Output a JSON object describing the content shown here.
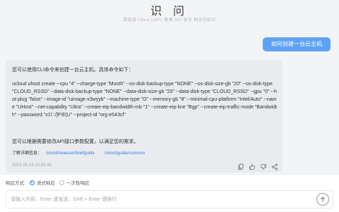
{
  "header": {
    "title": "识 问",
    "subtitle": "我知道 UHost URTC 备案 SPT 安全 相关的知识"
  },
  "chat": {
    "question": "如何创建一台云主机",
    "answer": {
      "intro": "您可以使用CLI命令来创建一台云主机。具体命令如下：",
      "command": "ucloud uhost create --cpu \"4\" --charge-type \"Month\" --os-disk-backup-type \"NONE\" --os-disk-size-gb \"20\" --os-disk-type \"CLOUD_RSSD\" --data-disk-backup-type \"NONE\" --data-disk-size-gb \"20\" --data-disk-type \"CLOUD_RSSD\" --gpu \"0\" --hot-plug \"false\" --image-id \"uimage-x3wyyb\" --machine-type \"O\" --memory-gb \"8\" --minimal-cpu-platform \"Intel/Auto\" --name \"UHost\" --net-capability \"Ultra\" --create-eip-bandwidth-mb \"1\" --create-eip-line \"Bgp\" --create-eip-traffic-mode \"Bandwidth\" --password \"x1\\`:/]F!E|U\" --project-id \"org-e543cf\"",
      "after": "您可以根据需要修改API接口参数配置，以满足您的需求。",
      "more_label": "了解详细信息：",
      "links": [
        "/uhost/newuser/briefguide",
        "/uhost/guide/common"
      ],
      "timestamp": "2023-06-19 20:53:46"
    }
  },
  "footer": {
    "mode_label": "响应方式:",
    "options": [
      {
        "label": "流式响应",
        "selected": true
      },
      {
        "label": "一次性响应",
        "selected": false
      }
    ],
    "input_placeholder": "请输入内容，Enter 键发送，Shift + Enter 键换行"
  },
  "colors": {
    "accent": "#5ea2f5",
    "link": "#2e7fe8",
    "answer_bg": "#e9ebee",
    "page_bg": "#f3f4f6"
  },
  "icons": [
    "copy-icon",
    "thumbs-up-icon",
    "thumbs-down-icon",
    "share-icon",
    "send-icon"
  ]
}
